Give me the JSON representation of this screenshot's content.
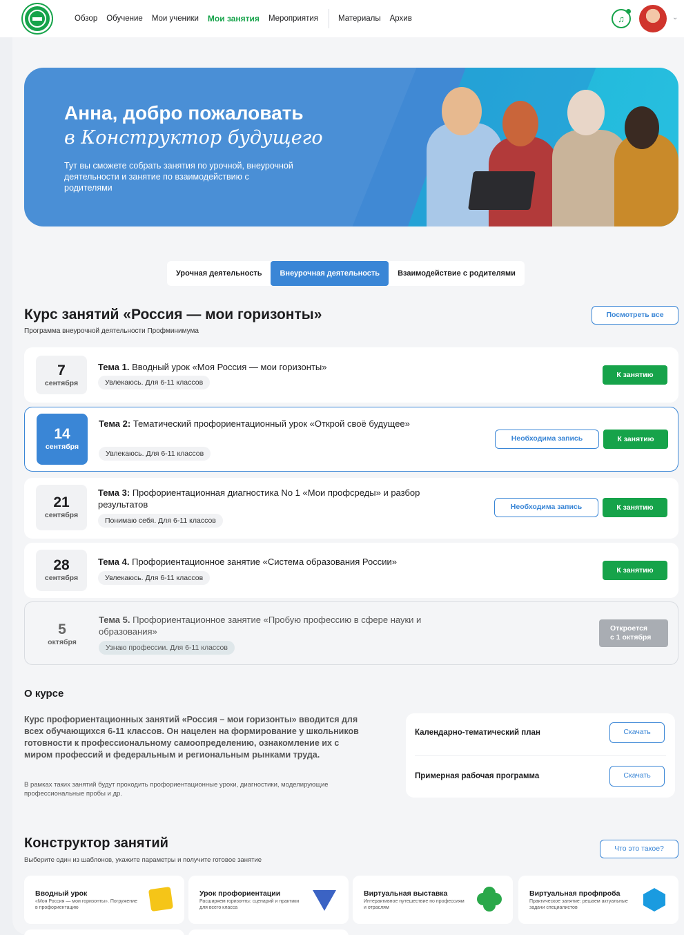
{
  "nav": {
    "items": [
      "Обзор",
      "Обучение",
      "Мои ученики",
      "Мои занятия",
      "Мероприятия"
    ],
    "extra": [
      "Материалы",
      "Архив"
    ],
    "active_index": 3
  },
  "hero": {
    "title": "Анна, добро пожаловать",
    "title_italic": "в Конструктор будущего",
    "text": "Тут вы сможете собрать занятия по урочной, внеурочной деятельности и занятие по взаимодействию с родителями"
  },
  "tabs": [
    {
      "label": "Урочная деятельность",
      "active": false
    },
    {
      "label": "Внеурочная деятельность",
      "active": true
    },
    {
      "label": "Взаимодействие с родителями",
      "active": false
    }
  ],
  "course": {
    "title": "Курс занятий «Россия — мои горизонты»",
    "subtitle": "Программа внеурочной деятельности Профминимума",
    "view_all": "Посмотреть все"
  },
  "lessons": [
    {
      "day": "7",
      "month": "сентября",
      "topic": "Тема 1.",
      "title": "Вводный урок «Моя Россия — мои горизонты»",
      "tag": "Увлекаюсь. Для 6-11 классов",
      "go": "К занятию"
    },
    {
      "day": "14",
      "month": "сентября",
      "topic": "Тема 2:",
      "title": "Тематический профориентационный урок «Открой своё будущее»",
      "tag": "Увлекаюсь. Для 6-11 классов",
      "register": "Необходима запись",
      "go": "К занятию"
    },
    {
      "day": "21",
      "month": "сентября",
      "topic": "Тема 3:",
      "title": "Профориентационная диагностика No 1 «Мои профсреды» и разбор результатов",
      "tag": "Понимаю себя. Для 6-11 классов",
      "register": "Необходима запись",
      "go": "К занятию"
    },
    {
      "day": "28",
      "month": "сентября",
      "topic": "Тема 4.",
      "title": "Профориентационное занятие «Система образования России»",
      "tag": "Увлекаюсь. Для 6-11 классов",
      "go": "К занятию"
    },
    {
      "day": "5",
      "month": "октября",
      "topic": "Тема 5.",
      "title": "Профориентационное занятие «Пробую профессию в сфере науки и образования»",
      "tag": "Узнаю профессии. Для 6-11 классов",
      "lock_line1": "Откроется",
      "lock_line2": "с 1 октября"
    }
  ],
  "about": {
    "heading": "О курсе",
    "bold": "Курс профориентационных занятий «Россия – мои горизонты» вводится для всех обучающихся 6-11 классов. Он нацелен на формирование у школьников готовности к профессиональному самоопределению, ознакомление их с миром профессий и федеральным и региональным рынками труда.",
    "small": "В рамках таких занятий будут проходить профориентационные уроки, диагностики, моделирующие профессиональные пробы и др.",
    "docs": [
      {
        "label": "Календарно-тематический план",
        "button": "Скачать"
      },
      {
        "label": "Примерная рабочая программа",
        "button": "Скачать"
      }
    ]
  },
  "constructor": {
    "heading": "Конструктор занятий",
    "subtitle": "Выберите один из шаблонов, укажите параметры и получите готовое занятие",
    "what_is": "Что это такое?",
    "templates": [
      {
        "title": "Вводный урок",
        "desc": "«Моя Россия — мои горизонты». Погружение в профориентацию",
        "color": "#f5c518"
      },
      {
        "title": "Урок профориентации",
        "desc": "Расширяем горизонты: сценарий и практики для всего класса",
        "color": "#3b63c4"
      },
      {
        "title": "Виртуальная выставка",
        "desc": "Интерактивное путешествие по профессиям и отраслям",
        "color": "#2aa84a"
      },
      {
        "title": "Виртуальная профпроба",
        "desc": "Практическое занятие: решаем актуальные задачи специалистов",
        "color": "#1a9be0"
      }
    ]
  },
  "colors": {
    "green": "#16a34a",
    "blue": "#3a86d6",
    "hero": "#4a8fd6",
    "hero_alt": "#1fb5d9"
  }
}
